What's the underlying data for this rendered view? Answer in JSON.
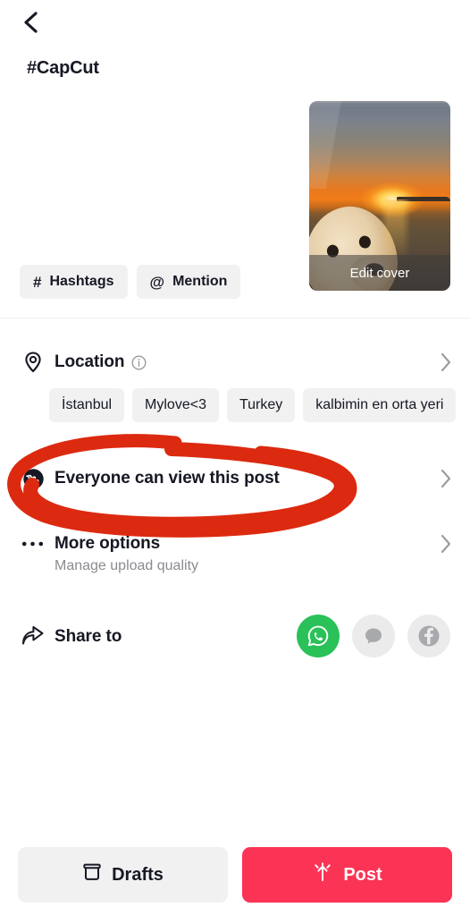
{
  "header": {
    "back_icon": "chevron-left-icon"
  },
  "caption": {
    "text": "#CapCut",
    "thumbnail": {
      "edit_cover_label": "Edit cover",
      "description": "sunset over sea with dog face"
    }
  },
  "tag_buttons": [
    {
      "glyph": "#",
      "label": "Hashtags",
      "icon": "hashtag-icon"
    },
    {
      "glyph": "@",
      "label": "Mention",
      "icon": "at-icon"
    }
  ],
  "rows": {
    "location": {
      "label": "Location",
      "icon": "map-pin-icon",
      "info_icon": "info-circle-icon",
      "chevron": "chevron-right-icon",
      "suggestions": [
        "İstanbul",
        "Mylove<3",
        "Turkey",
        "kalbimin en orta yeri"
      ]
    },
    "privacy": {
      "label": "Everyone can view this post",
      "icon": "globe-icon",
      "chevron": "chevron-right-icon"
    },
    "more_options": {
      "label": "More options",
      "subtitle": "Manage upload quality",
      "icon": "ellipsis-icon",
      "chevron": "chevron-right-icon"
    },
    "share_to": {
      "label": "Share to",
      "icon": "share-arrow-icon",
      "targets": [
        {
          "name": "whatsapp-share-icon",
          "label": "WhatsApp",
          "color": "#2ac158"
        },
        {
          "name": "sms-share-icon",
          "label": "SMS",
          "color": "#ebebec"
        },
        {
          "name": "facebook-share-icon",
          "label": "Facebook",
          "color": "#ebebec"
        }
      ]
    }
  },
  "annotation": {
    "type": "hand-drawn-ellipse",
    "color": "#dc2a10",
    "targets_label": "Everyone can view this post"
  },
  "bottom_bar": {
    "drafts": {
      "label": "Drafts",
      "icon": "drafts-box-icon"
    },
    "post": {
      "label": "Post",
      "icon": "upload-sparkle-icon",
      "color": "#fb3455"
    }
  }
}
